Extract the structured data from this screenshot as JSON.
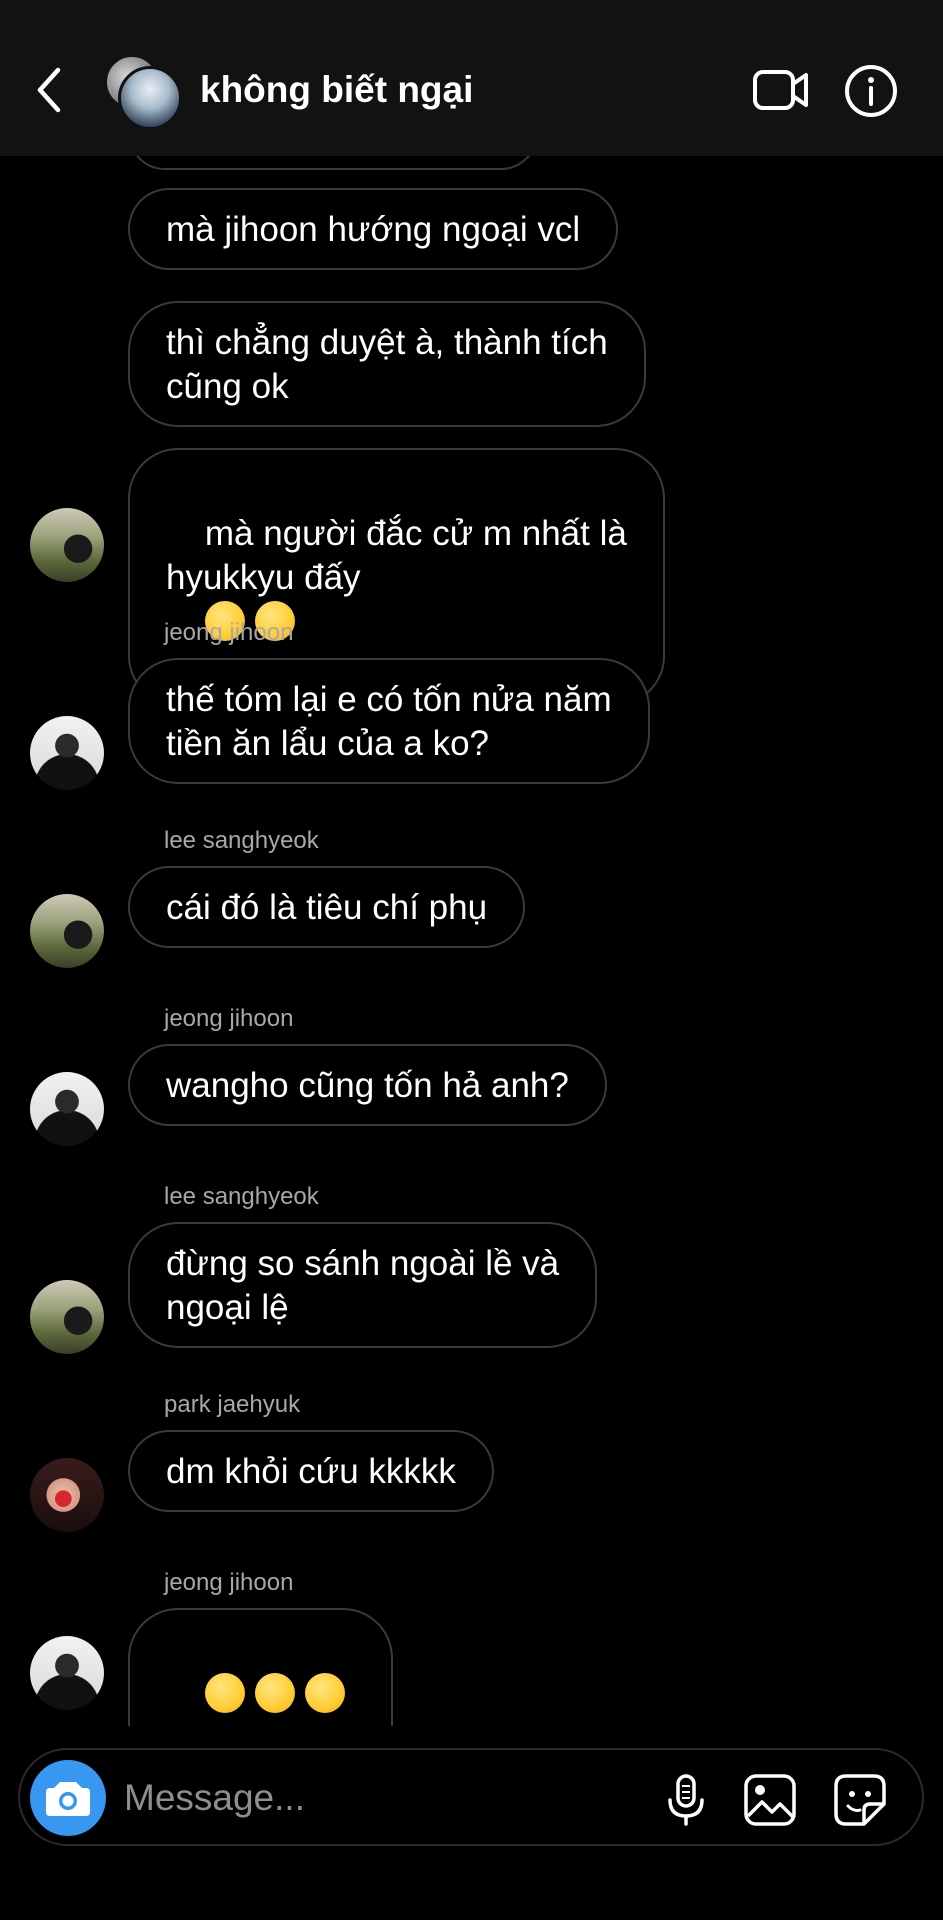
{
  "header": {
    "title": "không biết ngại",
    "back_icon": "chevron-left-icon",
    "video_icon": "video-camera-icon",
    "info_icon": "info-icon"
  },
  "messages": [
    {
      "text": "mà jihoon hướng ngoại vcl"
    },
    {
      "text": "thì chẳng duyệt à, thành tích\ncũng ok"
    },
    {
      "text": "mà người đắc cử m nhất là\nhyukkyu đấy",
      "emoji": [
        "grinning-sweat-emoji",
        "grinning-sweat-emoji"
      ]
    },
    {
      "sender": "jeong jihoon",
      "text": "thế tóm lại e có tốn nửa năm\ntiền ăn lẩu của a ko?"
    },
    {
      "sender": "lee sanghyeok",
      "text": "cái đó là tiêu chí phụ"
    },
    {
      "sender": "jeong jihoon",
      "text": "wangho cũng tốn hả anh?"
    },
    {
      "sender": "lee sanghyeok",
      "text": "đừng so sánh ngoài lề và\nngoại lệ"
    },
    {
      "sender": "park jaehyuk",
      "text": "dm khỏi cứu kkkkk"
    },
    {
      "sender": "jeong jihoon",
      "emoji": [
        "loudly-crying-emoji",
        "loudly-crying-emoji",
        "loudly-crying-emoji"
      ]
    }
  ],
  "composer": {
    "placeholder": "Message...",
    "accent": "#3897f0"
  }
}
